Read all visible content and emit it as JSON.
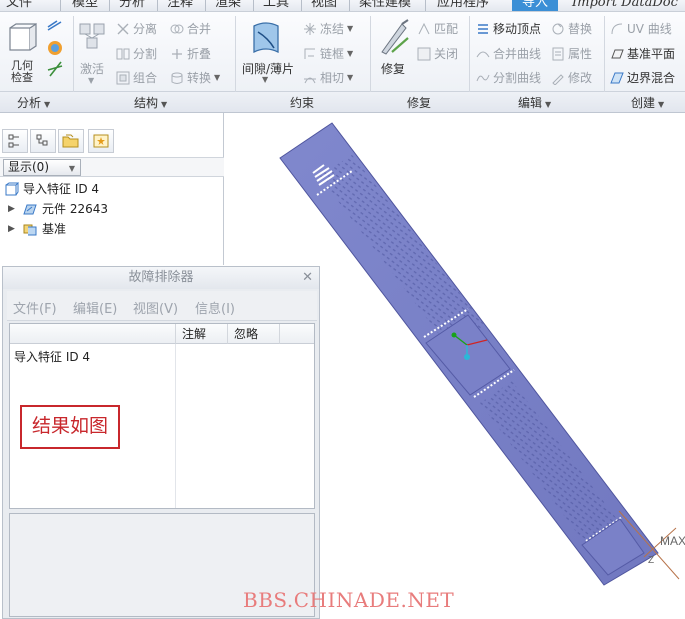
{
  "menu_tabs": [
    "文件",
    "模型",
    "分析",
    "注释",
    "渲染",
    "工具",
    "视图",
    "柔性建模",
    "应用程序",
    "导入",
    "Import DataDoc"
  ],
  "active_tab": "导入",
  "ribbon": {
    "analysis": {
      "label": "分析",
      "check_button": "几何检查"
    },
    "structure": {
      "label": "结构",
      "activate": "激活",
      "separate": "分离",
      "merge": "合并",
      "split": "分割",
      "fold": "折叠",
      "combine": "组合",
      "convert": "转换"
    },
    "constraint": {
      "label": "约束",
      "gap_sheet": "间隙/薄片",
      "freeze": "冻结",
      "chain": "链框",
      "trim": "相切"
    },
    "repair": {
      "label": "修复",
      "repair": "修复",
      "match": "匹配",
      "close": "关闭"
    },
    "edit": {
      "label": "编辑",
      "move_vertex": "移动顶点",
      "merge_curve": "合并曲线",
      "split_curve": "分割曲线",
      "replace": "替换",
      "property": "属性",
      "modify": "修改"
    },
    "create": {
      "label": "创建",
      "uv_curve": "UV 曲线",
      "datum_plane": "基准平面",
      "boundary_blend": "边界混合"
    }
  },
  "model_tree": {
    "show_label": "显示(0)",
    "items": [
      {
        "label": "导入特征 ID 4",
        "level": 0
      },
      {
        "label": "元件 22643",
        "level": 1
      },
      {
        "label": "基准",
        "level": 1
      }
    ]
  },
  "troubleshooter": {
    "title": "故障排除器",
    "menu": [
      "文件(F)",
      "编辑(E)",
      "视图(V)",
      "信息(I)"
    ],
    "columns": [
      "",
      "注解",
      "忽略"
    ],
    "rows": [
      {
        "feature": "导入特征 ID 4",
        "note": "",
        "ignore": ""
      }
    ]
  },
  "annotation": "结果如图",
  "watermark": "BBS.CHINADE.NET",
  "viewport": {
    "csys_label": "MAX",
    "axis_label": "Z"
  },
  "colors": {
    "accent": "#3b8fd6",
    "part": "#7f86c9",
    "annotation": "#c8272c",
    "watermark": "#e87c7c"
  }
}
